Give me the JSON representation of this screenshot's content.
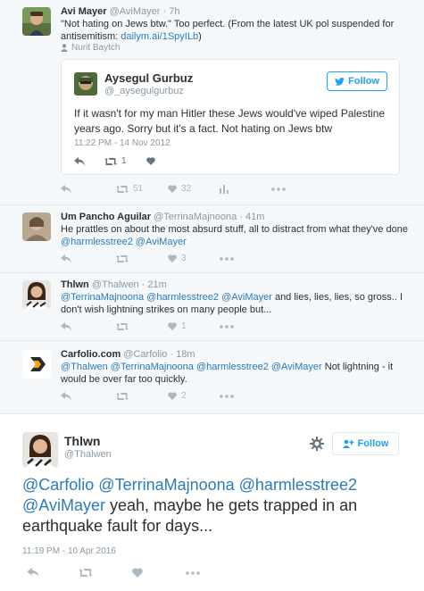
{
  "tweet1": {
    "name": "Avi Mayer",
    "handle": "@AviMayer",
    "time": "· 7h",
    "text_pre": "\"Not hating on Jews btw.\" Too perfect. (From the latest UK pol suspended for antisemitism: ",
    "link": "dailym.ai/1SpyILb",
    "text_post": ")",
    "attribution": "Nurit Baytch",
    "retweets": "51",
    "likes": "32"
  },
  "quoted": {
    "name": "Aysegul Gurbuz",
    "handle": "@_aysegulgurbuz",
    "follow_label": "Follow",
    "text": "If it wasn't for my man Hitler these Jews would've wiped Palestine years ago. Sorry but it's a fact. Not hating on Jews btw",
    "timestamp": "11:22 PM - 14 Nov 2012",
    "retweets": "1"
  },
  "tweet2": {
    "name": "Um Pancho Aguilar",
    "handle": "@TerrinaMajnoona",
    "time": "· 41m",
    "text_a": "He prattles on about the most absurd stuff, all to distract from what they've done ",
    "mentions": "@harmlesstree2 @AviMayer",
    "likes": "3"
  },
  "tweet3": {
    "name": "Thlwn",
    "handle": "@Thalwen",
    "time": "· 21m",
    "mentions": "@TerrinaMajnoona @harmlesstree2 @AviMayer",
    "text": " and lies, lies, lies, so gross.. I don't wish lightning strikes on many people but...",
    "likes": "1"
  },
  "tweet4": {
    "name": "Carfolio.com",
    "handle": "@Carfolio",
    "time": "· 18m",
    "mentions": "@Thalwen @TerrinaMajnoona @harmlesstree2 @AviMayer",
    "text": " Not lightning - it would be over far too quickly.",
    "likes": "2"
  },
  "main": {
    "name": "Thlwn",
    "handle": "@Thalwen",
    "follow_label": "Follow",
    "mentions": "@Carfolio @TerrinaMajnoona @harmlesstree2 @AviMayer",
    "text": " yeah, maybe he gets trapped in an earthquake fault for days...",
    "timestamp": "11:19 PM - 10 Apr 2016"
  },
  "colors": {
    "accent": "#2b7bb9",
    "follow_blue": "#1da1f2",
    "muted": "#8899a6",
    "icon_gray": "#aab8c2",
    "thread_bg": "#f5f8fa"
  }
}
